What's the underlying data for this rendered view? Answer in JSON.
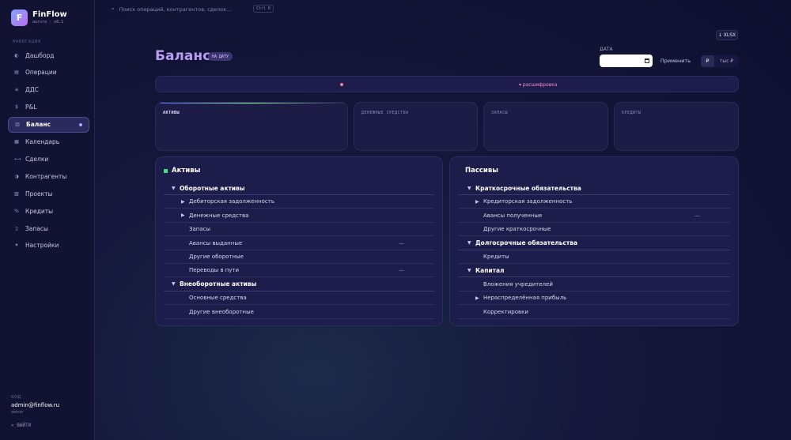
{
  "app": {
    "name": "FinFlow",
    "sub": "aurora · v8.1"
  },
  "sidebar": {
    "section": "НАВИГАЦИЯ",
    "items": [
      {
        "icon": "◐",
        "label": "Дашборд"
      },
      {
        "icon": "▤",
        "label": "Операции"
      },
      {
        "icon": "≡",
        "label": "ДДС"
      },
      {
        "icon": "$",
        "label": "P&L"
      },
      {
        "icon": "▥",
        "label": "Баланс",
        "active": true
      },
      {
        "icon": "▦",
        "label": "Календарь"
      },
      {
        "icon": "⟷",
        "label": "Сделки"
      },
      {
        "icon": "◑",
        "label": "Контрагенты"
      },
      {
        "icon": "▧",
        "label": "Проекты"
      },
      {
        "icon": "%",
        "label": "Кредиты"
      },
      {
        "icon": "▯",
        "label": "Запасы"
      },
      {
        "icon": "✦",
        "label": "Настройки"
      }
    ],
    "user": {
      "label": "ВХОД",
      "email": "admin@finflow.ru",
      "role": "owner"
    },
    "logout": "✕ ВЫЙТИ"
  },
  "search": {
    "placeholder": "Поиск операций, контрагентов, сделок...",
    "shortcut": "Ctrl K"
  },
  "header": {
    "title": "Баланс",
    "badge": "НА ДАТУ",
    "date_label": "ДАТА",
    "apply": "Применить",
    "units": [
      "₽",
      "тыс ₽"
    ],
    "export": "↓ XLSX"
  },
  "info": {
    "decode": "▾ расшифровка"
  },
  "kpis": [
    "АКТИВЫ",
    "ДЕНЕЖНЫЕ СРЕДСТВА",
    "ЗАПАСЫ",
    "КРЕДИТЫ"
  ],
  "assets": {
    "title": "Активы",
    "rows": [
      {
        "label": "Оборотные активы",
        "group": true,
        "tri": "▼"
      },
      {
        "label": "Дебиторская задолженность",
        "tri": "▶"
      },
      {
        "label": "Денежные средства",
        "tri": "▶"
      },
      {
        "label": "Запасы"
      },
      {
        "label": "Авансы выданные",
        "dash": "—"
      },
      {
        "label": "Другие оборотные"
      },
      {
        "label": "Переводы в пути",
        "dash": "—"
      },
      {
        "label": "Внеоборотные активы",
        "group": true,
        "tri": "▼"
      },
      {
        "label": "Основные средства"
      },
      {
        "label": "Другие внеоборотные"
      }
    ]
  },
  "liabilities": {
    "title": "Пассивы",
    "rows": [
      {
        "label": "Краткосрочные обязательства",
        "group": true,
        "tri": "▼"
      },
      {
        "label": "Кредиторская задолженность",
        "tri": "▶"
      },
      {
        "label": "Авансы полученные",
        "dash": "—"
      },
      {
        "label": "Другие краткосрочные"
      },
      {
        "label": "Долгосрочные обязательства",
        "group": true,
        "tri": "▼"
      },
      {
        "label": "Кредиты"
      },
      {
        "label": "Капитал",
        "group": true,
        "tri": "▼"
      },
      {
        "label": "Вложения учредителей"
      },
      {
        "label": "Нераспределённая прибыль",
        "tri": "▶"
      },
      {
        "label": "Корректировки"
      }
    ]
  }
}
